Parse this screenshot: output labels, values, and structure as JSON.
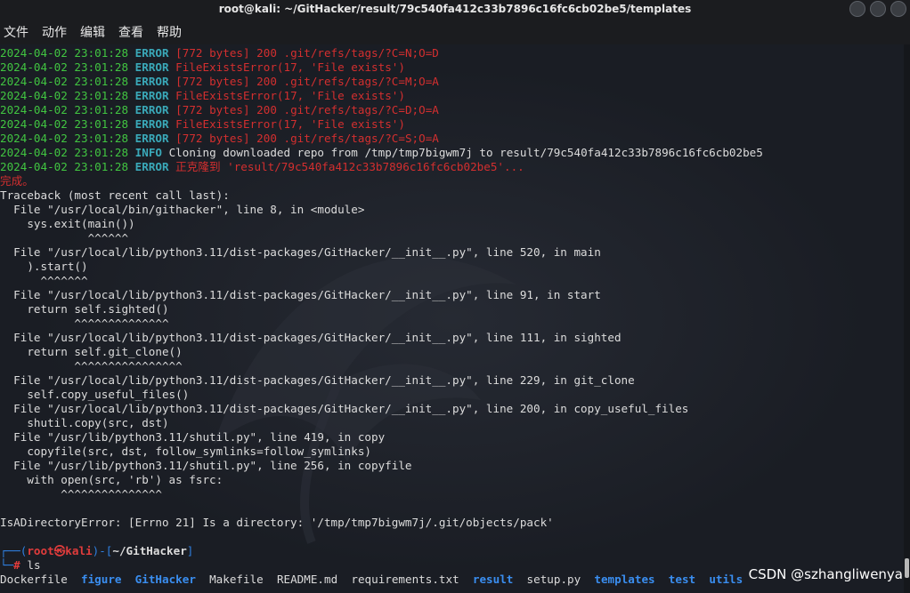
{
  "window": {
    "title": "root@kali: ~/GitHacker/result/79c540fa412c33b7896c16fc6cb02be5/templates"
  },
  "menu": [
    "文件",
    "动作",
    "编辑",
    "查看",
    "帮助"
  ],
  "log_lines": [
    {
      "ts": "2024-04-02 23:01:28",
      "level": "ERROR",
      "msg": "[772 bytes] 200 .git/refs/tags/?C=N;O=D"
    },
    {
      "ts": "2024-04-02 23:01:28",
      "level": "ERROR",
      "msg": "FileExistsError(17, 'File exists')"
    },
    {
      "ts": "2024-04-02 23:01:28",
      "level": "ERROR",
      "msg": "[772 bytes] 200 .git/refs/tags/?C=M;O=A"
    },
    {
      "ts": "2024-04-02 23:01:28",
      "level": "ERROR",
      "msg": "FileExistsError(17, 'File exists')"
    },
    {
      "ts": "2024-04-02 23:01:28",
      "level": "ERROR",
      "msg": "[772 bytes] 200 .git/refs/tags/?C=D;O=A"
    },
    {
      "ts": "2024-04-02 23:01:28",
      "level": "ERROR",
      "msg": "FileExistsError(17, 'File exists')"
    },
    {
      "ts": "2024-04-02 23:01:28",
      "level": "ERROR",
      "msg": "[772 bytes] 200 .git/refs/tags/?C=S;O=A"
    },
    {
      "ts": "2024-04-02 23:01:28",
      "level": "INFO",
      "msg": "Cloning downloaded repo from /tmp/tmp7bigwm7j to result/79c540fa412c33b7896c16fc6cb02be5"
    },
    {
      "ts": "2024-04-02 23:01:28",
      "level": "ERROR",
      "msg": "正克隆到 'result/79c540fa412c33b7896c16fc6cb02be5'..."
    }
  ],
  "done_text": "完成。",
  "traceback": [
    "Traceback (most recent call last):",
    "  File \"/usr/local/bin/githacker\", line 8, in <module>",
    "    sys.exit(main())",
    "             ^^^^^^",
    "  File \"/usr/local/lib/python3.11/dist-packages/GitHacker/__init__.py\", line 520, in main",
    "    ).start()",
    "      ^^^^^^^",
    "  File \"/usr/local/lib/python3.11/dist-packages/GitHacker/__init__.py\", line 91, in start",
    "    return self.sighted()",
    "           ^^^^^^^^^^^^^^",
    "  File \"/usr/local/lib/python3.11/dist-packages/GitHacker/__init__.py\", line 111, in sighted",
    "    return self.git_clone()",
    "           ^^^^^^^^^^^^^^^^",
    "  File \"/usr/local/lib/python3.11/dist-packages/GitHacker/__init__.py\", line 229, in git_clone",
    "    self.copy_useful_files()",
    "  File \"/usr/local/lib/python3.11/dist-packages/GitHacker/__init__.py\", line 200, in copy_useful_files",
    "    shutil.copy(src, dst)",
    "  File \"/usr/lib/python3.11/shutil.py\", line 419, in copy",
    "    copyfile(src, dst, follow_symlinks=follow_symlinks)",
    "  File \"/usr/lib/python3.11/shutil.py\", line 256, in copyfile",
    "    with open(src, 'rb') as fsrc:",
    "         ^^^^^^^^^^^^^^^",
    "",
    "IsADirectoryError: [Errno 21] Is a directory: '/tmp/tmp7bigwm7j/.git/objects/pack'",
    ""
  ],
  "prompt": {
    "user": "root",
    "at": "㉿",
    "host": "kali",
    "cwd": "~/GitHacker",
    "symbol": "#",
    "command": "ls"
  },
  "ls_output": [
    {
      "name": "Dockerfile",
      "dir": false
    },
    {
      "name": "figure",
      "dir": true
    },
    {
      "name": "GitHacker",
      "dir": true
    },
    {
      "name": "Makefile",
      "dir": false
    },
    {
      "name": "README.md",
      "dir": false
    },
    {
      "name": "requirements.txt",
      "dir": false
    },
    {
      "name": "result",
      "dir": true
    },
    {
      "name": "setup.py",
      "dir": false
    },
    {
      "name": "templates",
      "dir": true
    },
    {
      "name": "test",
      "dir": true
    },
    {
      "name": "utils",
      "dir": true
    }
  ],
  "watermark": "CSDN @szhangliwenya",
  "colors": {
    "timestamp": "#41c541",
    "level": "#3aa9b9",
    "error_msg": "#d32f2f",
    "directory": "#3a8ef0"
  }
}
